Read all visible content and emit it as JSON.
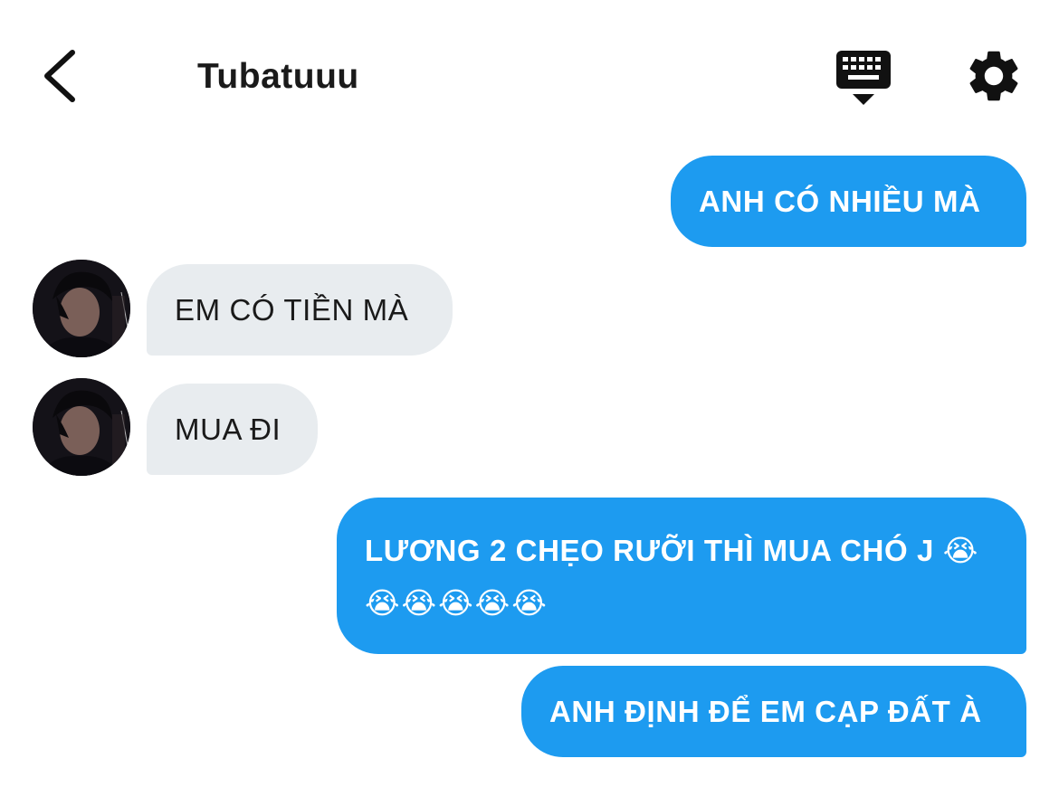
{
  "header": {
    "title": "Tubatuuu"
  },
  "messages": [
    {
      "direction": "outgoing",
      "text": "ANH CÓ NHIỀU MÀ"
    },
    {
      "direction": "incoming",
      "text": "EM CÓ TIỀN MÀ"
    },
    {
      "direction": "incoming",
      "text": "MUA ĐI"
    },
    {
      "direction": "outgoing",
      "line1": "LƯƠNG 2 CHẸO RƯỠI THÌ MUA CHÓ J 😭",
      "line2": "😭😭😭😭😭"
    },
    {
      "direction": "outgoing",
      "text": "ANH ĐỊNH ĐỂ EM CẠP ĐẤT À"
    }
  ],
  "icons": {
    "back": "chevron-left-icon",
    "keyboard": "keyboard-icon",
    "settings": "gear-icon"
  },
  "colors": {
    "outgoing_bubble": "#1d9bf0",
    "incoming_bubble": "#e8ecef",
    "text_dark": "#1a1a1a",
    "text_light": "#ffffff"
  }
}
